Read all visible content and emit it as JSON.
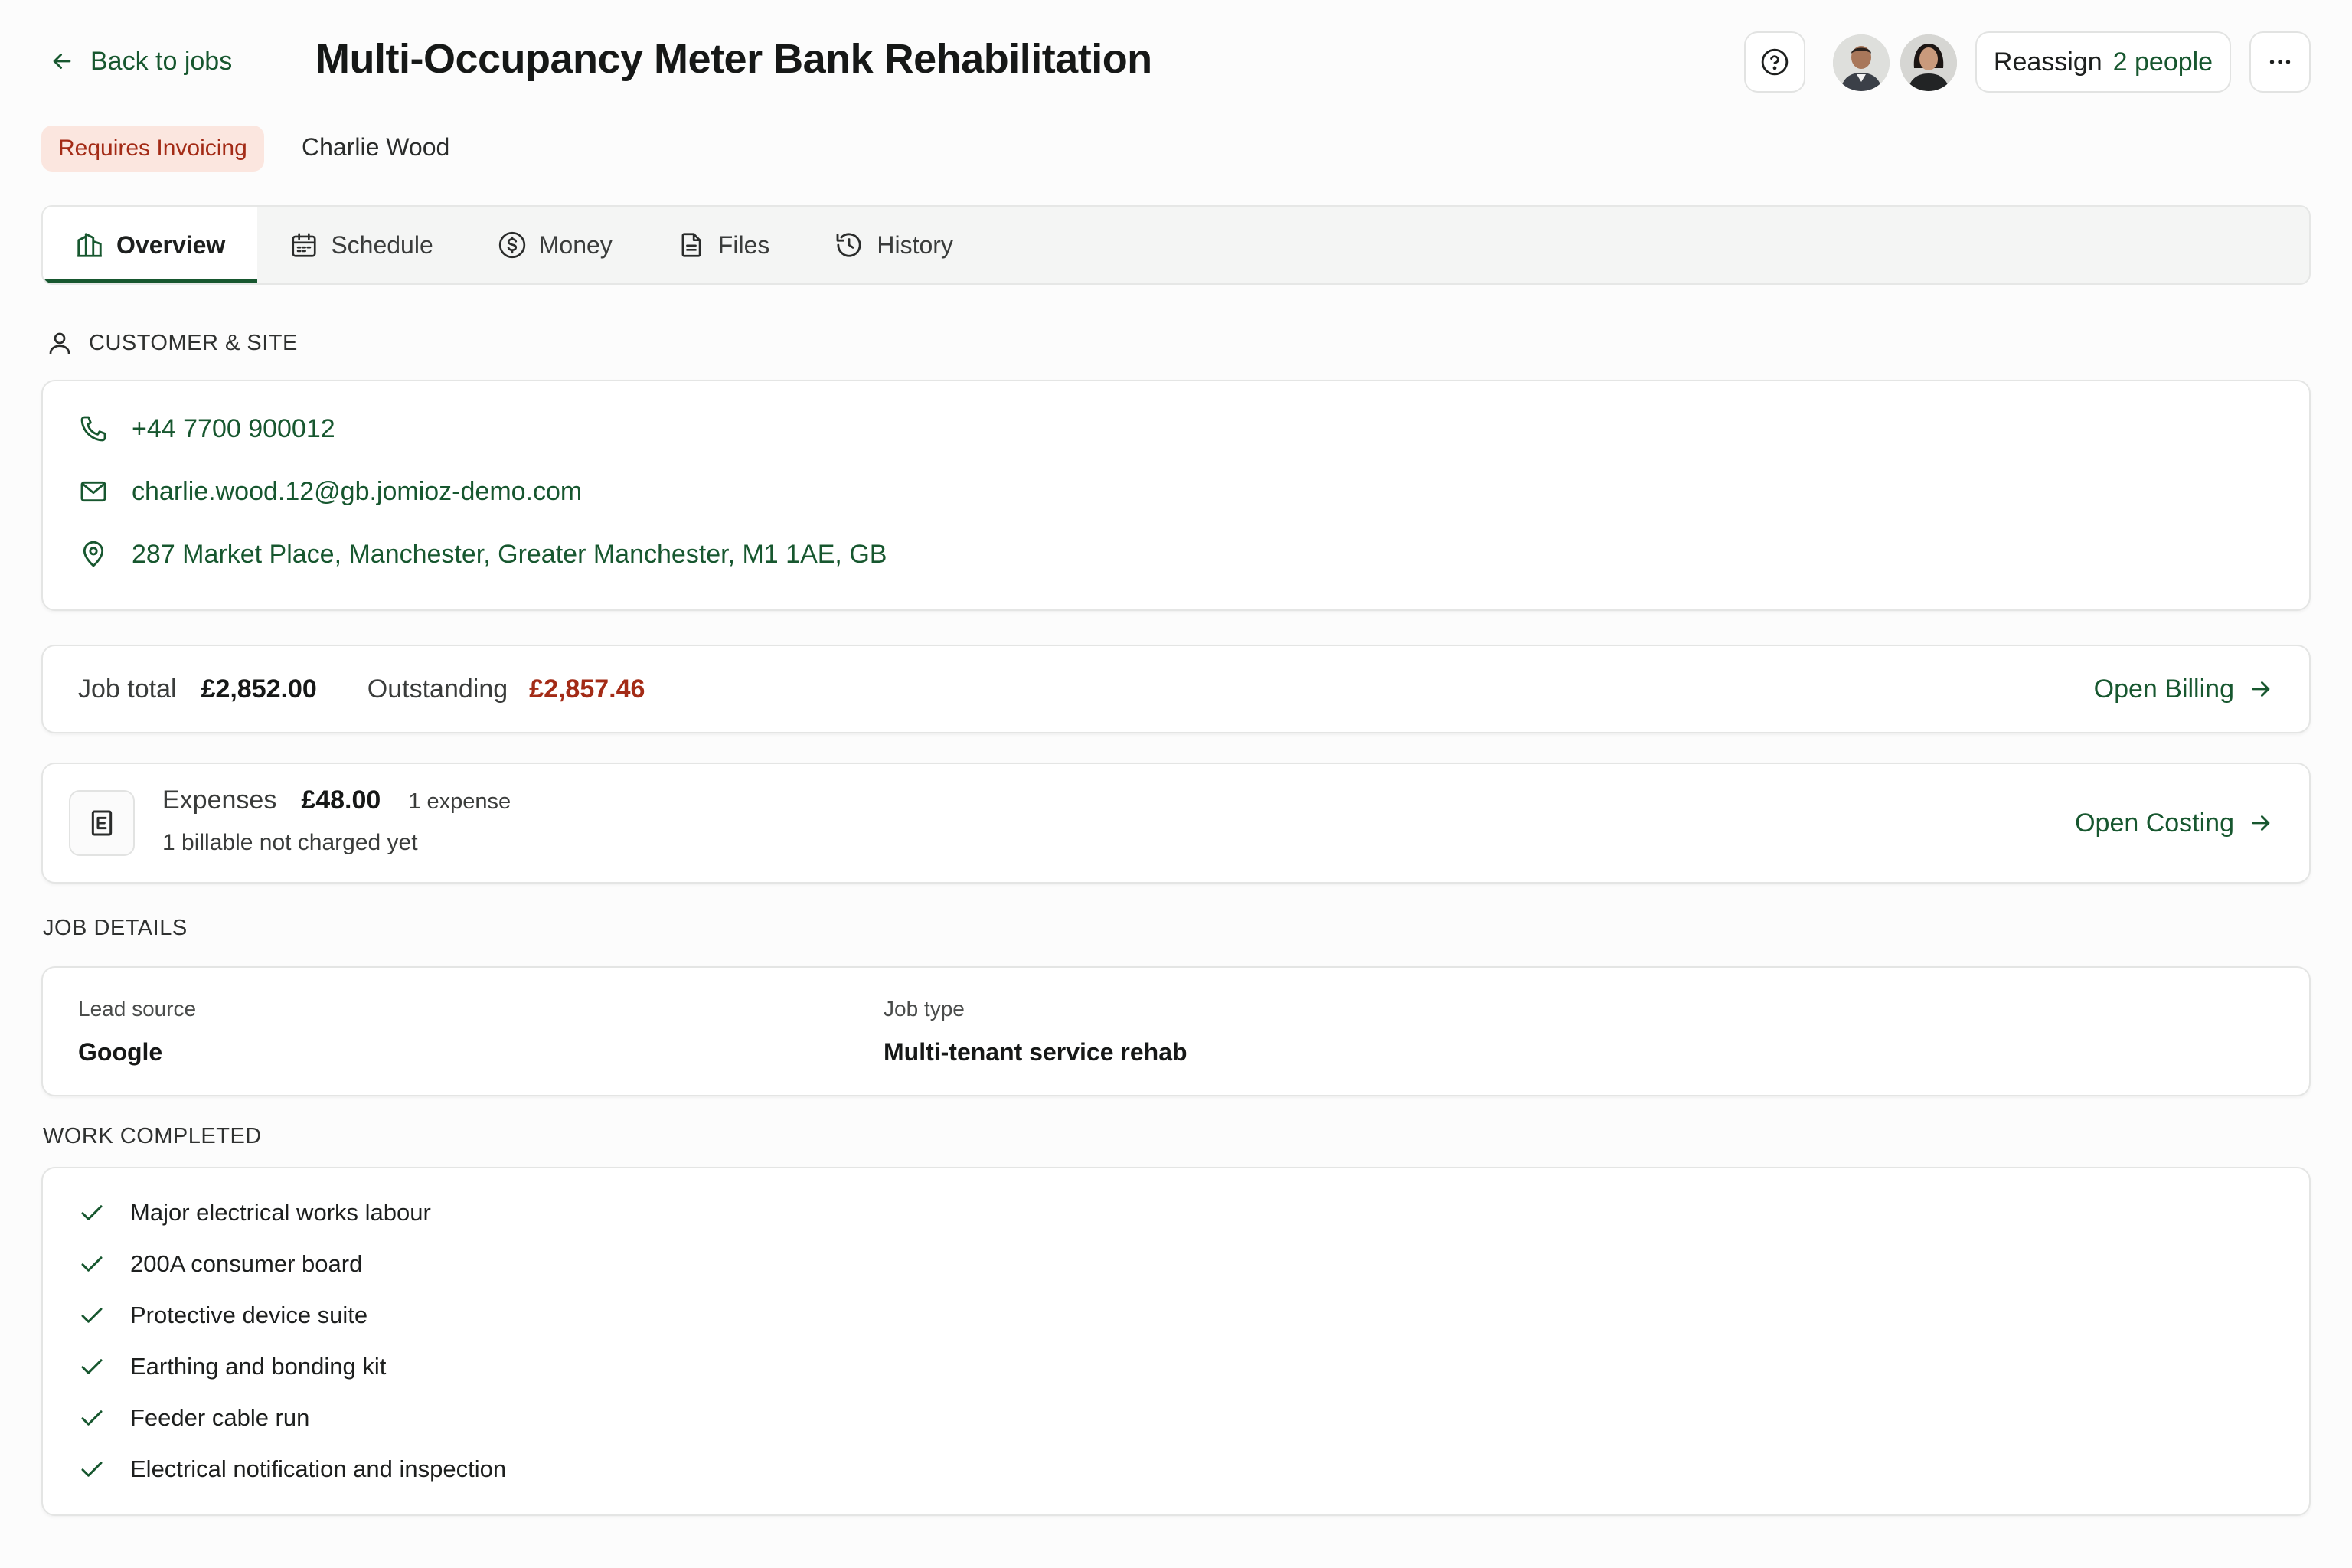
{
  "header": {
    "back_label": "Back to jobs",
    "title": "Multi-Occupancy Meter Bank Rehabilitation",
    "reassign_label": "Reassign",
    "reassign_count": "2 people"
  },
  "status": {
    "badge": "Requires Invoicing",
    "customer_name": "Charlie Wood"
  },
  "tabs": [
    {
      "label": "Overview",
      "icon": "building-icon",
      "active": true
    },
    {
      "label": "Schedule",
      "icon": "calendar-icon"
    },
    {
      "label": "Money",
      "icon": "dollar-icon"
    },
    {
      "label": "Files",
      "icon": "file-icon"
    },
    {
      "label": "History",
      "icon": "history-icon"
    }
  ],
  "customer_site": {
    "heading": "CUSTOMER & SITE",
    "phone": "+44 7700 900012",
    "email": "charlie.wood.12@gb.jomioz-demo.com",
    "address": "287 Market Place, Manchester, Greater Manchester, M1 1AE, GB"
  },
  "billing": {
    "job_total_label": "Job total",
    "job_total": "£2,852.00",
    "outstanding_label": "Outstanding",
    "outstanding": "£2,857.46",
    "link": "Open Billing"
  },
  "expenses": {
    "label": "Expenses",
    "amount": "£48.00",
    "count": "1 expense",
    "note": "1 billable not charged yet",
    "link": "Open Costing"
  },
  "job_details": {
    "heading": "JOB DETAILS",
    "lead_source_label": "Lead source",
    "lead_source": "Google",
    "job_type_label": "Job type",
    "job_type": "Multi-tenant service rehab"
  },
  "work_completed": {
    "heading": "WORK COMPLETED",
    "items": [
      "Major electrical works labour",
      "200A consumer board",
      "Protective device suite",
      "Earthing and bonding kit",
      "Feeder cable run",
      "Electrical notification and inspection"
    ]
  },
  "colors": {
    "accent": "#17572f",
    "danger": "#a32b16",
    "badge_bg": "#fbe6df"
  }
}
